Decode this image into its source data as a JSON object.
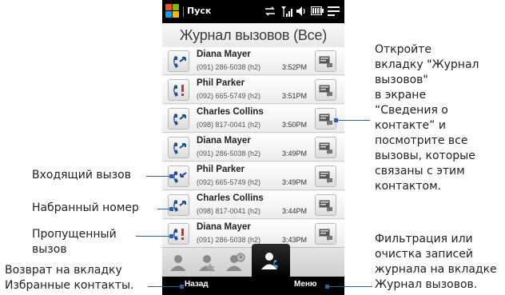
{
  "status_bar": {
    "start_label": "Пуск",
    "icons": [
      "sync-icon",
      "signal-icon",
      "volume-icon",
      "battery-icon",
      "menu-icon"
    ]
  },
  "screen_title": "Журнал вызовов (Все)",
  "calls": [
    {
      "name": "Diana Mayer",
      "number": "(091) 286-5038 (h2)",
      "time": "3:52PM",
      "type": "outgoing"
    },
    {
      "name": "Phil Parker",
      "number": "(092) 665-5749 (h2)",
      "time": "3:51PM",
      "type": "missed"
    },
    {
      "name": "Charles Collins",
      "number": "(098) 817-0041 (h2)",
      "time": "3:50PM",
      "type": "outgoing"
    },
    {
      "name": "Diana Mayer",
      "number": "(091) 286-5038 (h2)",
      "time": "3:49PM",
      "type": "outgoing"
    },
    {
      "name": "Phil Parker",
      "number": "(092) 665-5749 (h2)",
      "time": "3:49PM",
      "type": "incoming"
    },
    {
      "name": "Charles Collins",
      "number": "(098) 817-0041 (h2)",
      "time": "3:44PM",
      "type": "outgoing"
    },
    {
      "name": "Diana Mayer",
      "number": "(091) 286-5038 (h2)",
      "time": "3:43PM",
      "type": "missed"
    }
  ],
  "tabs": [
    "contact-card-tab",
    "favorites-tab",
    "recent-tab",
    "call-history-tab"
  ],
  "softkeys": {
    "left": "Назад",
    "right": "Меню"
  },
  "annotations": {
    "right_top": [
      "Откройте",
      "вкладку \"Журнал",
      "вызовов\"",
      "в экране",
      "“Сведения о",
      "контакте” и",
      "посмотрите все",
      "вызовы, которые",
      "связаны с этим",
      "контактом."
    ],
    "incoming": "Входящий вызов",
    "dialed": "Набранный номер",
    "missed": [
      "Пропущенный",
      "вызов"
    ],
    "back": [
      "Возврат на вкладку",
      "Избранные контакты."
    ],
    "right_bottom": [
      "Фильтрация или",
      "очистка записей",
      "журнала на вкладке",
      "Журнал вызовов."
    ]
  },
  "colors": {
    "accent": "#2e5fa8",
    "missed": "#c0392b",
    "call_icon": "#1f4f96"
  }
}
